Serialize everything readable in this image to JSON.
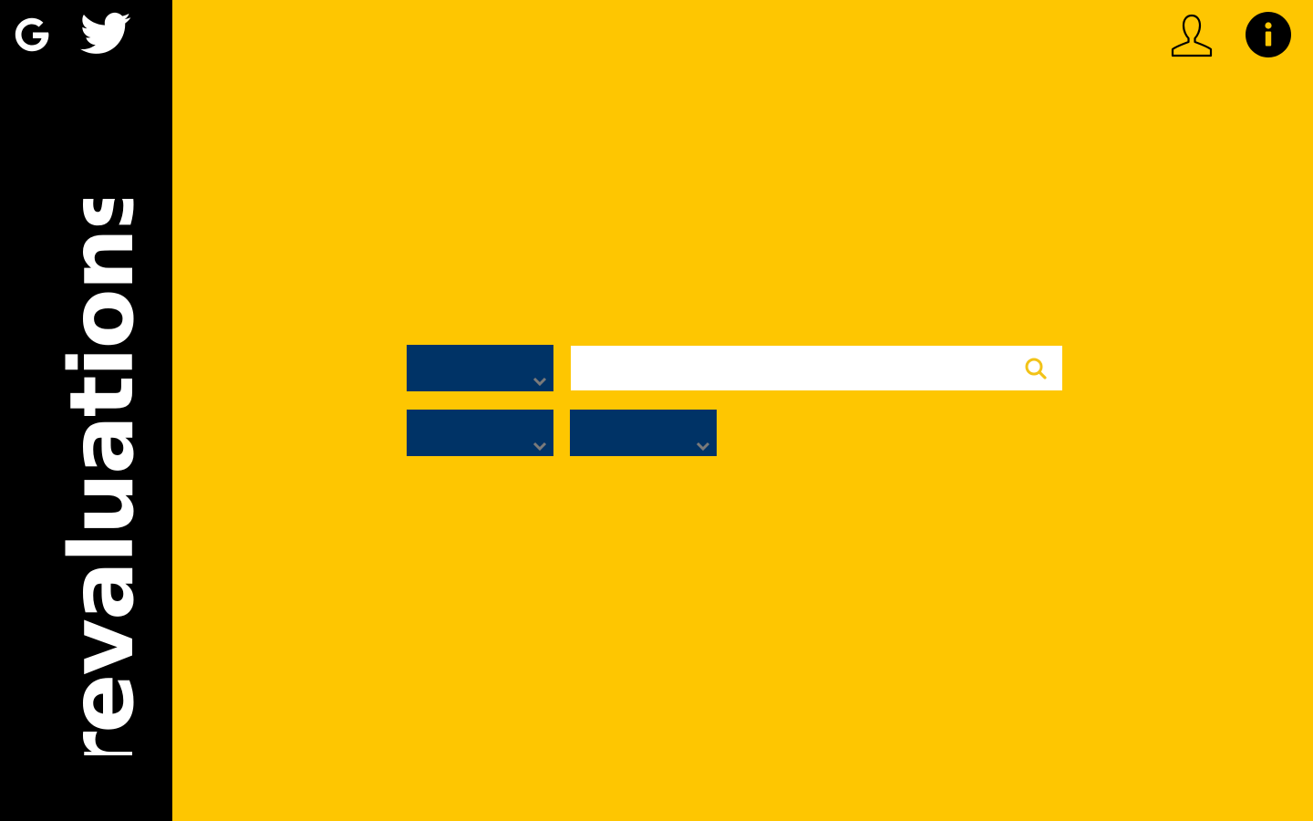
{
  "sidebar": {
    "brand": "revaluations",
    "social": [
      {
        "icon": "google-icon"
      },
      {
        "icon": "twitter-icon"
      }
    ]
  },
  "header": {
    "user_icon": "user-icon",
    "info_icon": "info-icon"
  },
  "search": {
    "value": "",
    "placeholder": "",
    "icon": "search-icon"
  },
  "filters": [
    {
      "value": ""
    },
    {
      "value": ""
    },
    {
      "value": ""
    }
  ],
  "colors": {
    "background": "#fec601",
    "sidebar": "#000000",
    "dropdown": "#003366",
    "chevron": "#7a7a7a",
    "search_icon": "#f2c318"
  }
}
